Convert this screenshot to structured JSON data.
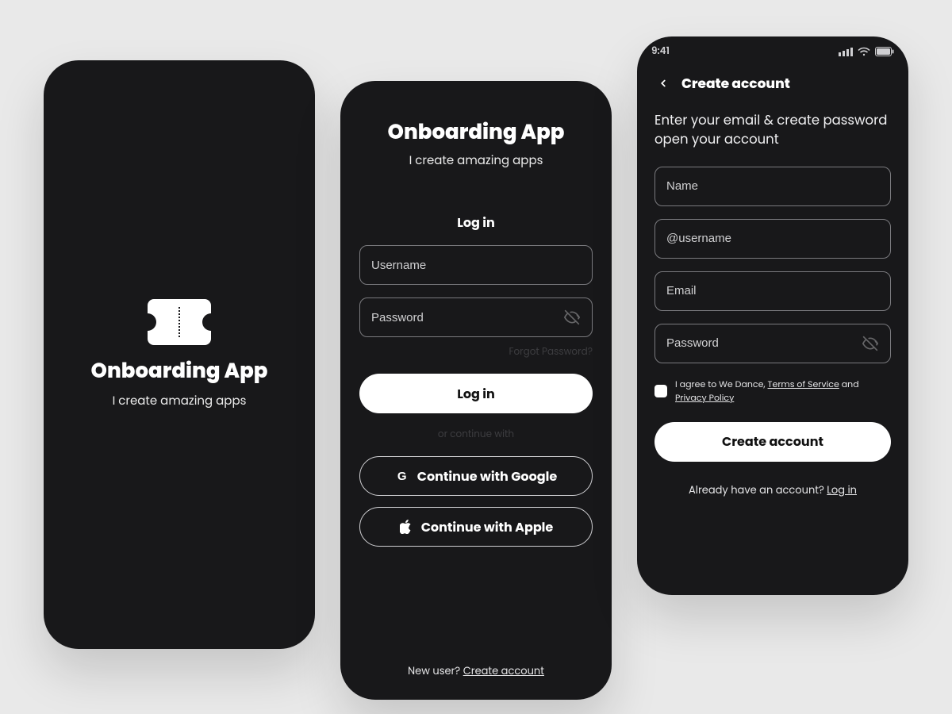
{
  "common": {
    "app_name": "Onboarding App",
    "tagline": "I create amazing apps"
  },
  "splash": {
    "logo_icon": "ticket-icon"
  },
  "login": {
    "section_label": "Log in",
    "username_placeholder": "Username",
    "password_placeholder": "Password",
    "forgot_label": "Forgot Password?",
    "login_button": "Log in",
    "or_label": "or continue with",
    "google_button": "Continue with Google",
    "apple_button": "Continue with Apple",
    "new_user_prompt": "New user? ",
    "create_account_link": "Create account"
  },
  "signup": {
    "status_time": "9:41",
    "screen_title": "Create account",
    "lead_text": "Enter your email & create password open your account",
    "name_placeholder": "Name",
    "username_placeholder": "@username",
    "email_placeholder": "Email",
    "password_placeholder": "Password",
    "agree_prefix": "I agree to We Dance, ",
    "tos_link": "Terms of Service",
    "agree_middle": " and ",
    "privacy_link": "Privacy Policy",
    "create_button": "Create account",
    "have_account_prompt": "Already have an account? ",
    "login_link": "Log in"
  }
}
